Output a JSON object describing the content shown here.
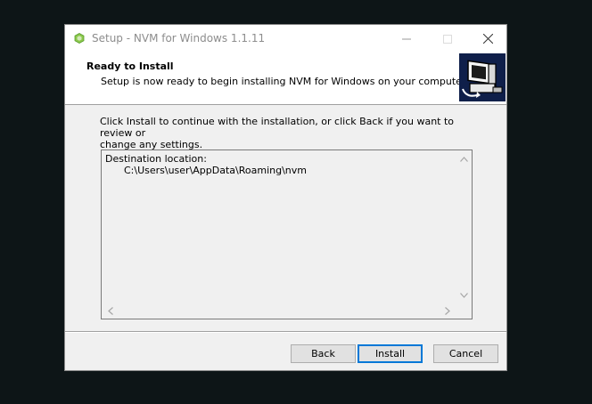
{
  "window": {
    "title": "Setup - NVM for Windows 1.1.11"
  },
  "header": {
    "title": "Ready to Install",
    "subtitle": "Setup is now ready to begin installing NVM for Windows on your computer."
  },
  "main": {
    "intro_line1": "Click Install to continue with the installation, or click Back if you want to review or",
    "intro_line2": "change any settings.",
    "memo_label": "Destination location:",
    "memo_path": "C:\\Users\\user\\AppData\\Roaming\\nvm"
  },
  "buttons": {
    "back": "Back",
    "install": "Install",
    "cancel": "Cancel"
  },
  "icons": {
    "app": "nodejs-hexagon-icon",
    "minimize": "minimize-icon",
    "maximize": "maximize-icon",
    "close": "close-icon",
    "wizard": "computer-install-icon"
  },
  "colors": {
    "accent": "#0078d7",
    "app_icon": "#6cc24a"
  }
}
